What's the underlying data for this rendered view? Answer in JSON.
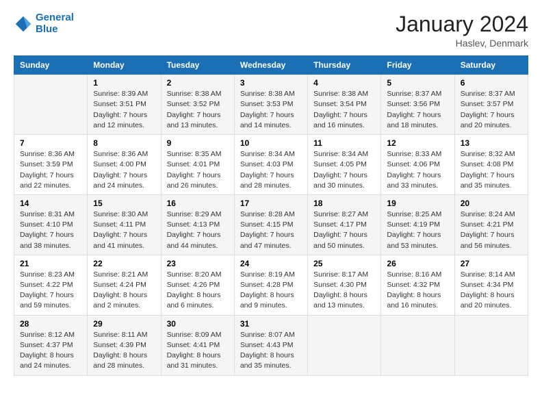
{
  "header": {
    "logo_line1": "General",
    "logo_line2": "Blue",
    "month_title": "January 2024",
    "location": "Haslev, Denmark"
  },
  "weekdays": [
    "Sunday",
    "Monday",
    "Tuesday",
    "Wednesday",
    "Thursday",
    "Friday",
    "Saturday"
  ],
  "weeks": [
    [
      {
        "day": "",
        "info": ""
      },
      {
        "day": "1",
        "info": "Sunrise: 8:39 AM\nSunset: 3:51 PM\nDaylight: 7 hours\nand 12 minutes."
      },
      {
        "day": "2",
        "info": "Sunrise: 8:38 AM\nSunset: 3:52 PM\nDaylight: 7 hours\nand 13 minutes."
      },
      {
        "day": "3",
        "info": "Sunrise: 8:38 AM\nSunset: 3:53 PM\nDaylight: 7 hours\nand 14 minutes."
      },
      {
        "day": "4",
        "info": "Sunrise: 8:38 AM\nSunset: 3:54 PM\nDaylight: 7 hours\nand 16 minutes."
      },
      {
        "day": "5",
        "info": "Sunrise: 8:37 AM\nSunset: 3:56 PM\nDaylight: 7 hours\nand 18 minutes."
      },
      {
        "day": "6",
        "info": "Sunrise: 8:37 AM\nSunset: 3:57 PM\nDaylight: 7 hours\nand 20 minutes."
      }
    ],
    [
      {
        "day": "7",
        "info": "Sunrise: 8:36 AM\nSunset: 3:59 PM\nDaylight: 7 hours\nand 22 minutes."
      },
      {
        "day": "8",
        "info": "Sunrise: 8:36 AM\nSunset: 4:00 PM\nDaylight: 7 hours\nand 24 minutes."
      },
      {
        "day": "9",
        "info": "Sunrise: 8:35 AM\nSunset: 4:01 PM\nDaylight: 7 hours\nand 26 minutes."
      },
      {
        "day": "10",
        "info": "Sunrise: 8:34 AM\nSunset: 4:03 PM\nDaylight: 7 hours\nand 28 minutes."
      },
      {
        "day": "11",
        "info": "Sunrise: 8:34 AM\nSunset: 4:05 PM\nDaylight: 7 hours\nand 30 minutes."
      },
      {
        "day": "12",
        "info": "Sunrise: 8:33 AM\nSunset: 4:06 PM\nDaylight: 7 hours\nand 33 minutes."
      },
      {
        "day": "13",
        "info": "Sunrise: 8:32 AM\nSunset: 4:08 PM\nDaylight: 7 hours\nand 35 minutes."
      }
    ],
    [
      {
        "day": "14",
        "info": "Sunrise: 8:31 AM\nSunset: 4:10 PM\nDaylight: 7 hours\nand 38 minutes."
      },
      {
        "day": "15",
        "info": "Sunrise: 8:30 AM\nSunset: 4:11 PM\nDaylight: 7 hours\nand 41 minutes."
      },
      {
        "day": "16",
        "info": "Sunrise: 8:29 AM\nSunset: 4:13 PM\nDaylight: 7 hours\nand 44 minutes."
      },
      {
        "day": "17",
        "info": "Sunrise: 8:28 AM\nSunset: 4:15 PM\nDaylight: 7 hours\nand 47 minutes."
      },
      {
        "day": "18",
        "info": "Sunrise: 8:27 AM\nSunset: 4:17 PM\nDaylight: 7 hours\nand 50 minutes."
      },
      {
        "day": "19",
        "info": "Sunrise: 8:25 AM\nSunset: 4:19 PM\nDaylight: 7 hours\nand 53 minutes."
      },
      {
        "day": "20",
        "info": "Sunrise: 8:24 AM\nSunset: 4:21 PM\nDaylight: 7 hours\nand 56 minutes."
      }
    ],
    [
      {
        "day": "21",
        "info": "Sunrise: 8:23 AM\nSunset: 4:22 PM\nDaylight: 7 hours\nand 59 minutes."
      },
      {
        "day": "22",
        "info": "Sunrise: 8:21 AM\nSunset: 4:24 PM\nDaylight: 8 hours\nand 2 minutes."
      },
      {
        "day": "23",
        "info": "Sunrise: 8:20 AM\nSunset: 4:26 PM\nDaylight: 8 hours\nand 6 minutes."
      },
      {
        "day": "24",
        "info": "Sunrise: 8:19 AM\nSunset: 4:28 PM\nDaylight: 8 hours\nand 9 minutes."
      },
      {
        "day": "25",
        "info": "Sunrise: 8:17 AM\nSunset: 4:30 PM\nDaylight: 8 hours\nand 13 minutes."
      },
      {
        "day": "26",
        "info": "Sunrise: 8:16 AM\nSunset: 4:32 PM\nDaylight: 8 hours\nand 16 minutes."
      },
      {
        "day": "27",
        "info": "Sunrise: 8:14 AM\nSunset: 4:34 PM\nDaylight: 8 hours\nand 20 minutes."
      }
    ],
    [
      {
        "day": "28",
        "info": "Sunrise: 8:12 AM\nSunset: 4:37 PM\nDaylight: 8 hours\nand 24 minutes."
      },
      {
        "day": "29",
        "info": "Sunrise: 8:11 AM\nSunset: 4:39 PM\nDaylight: 8 hours\nand 28 minutes."
      },
      {
        "day": "30",
        "info": "Sunrise: 8:09 AM\nSunset: 4:41 PM\nDaylight: 8 hours\nand 31 minutes."
      },
      {
        "day": "31",
        "info": "Sunrise: 8:07 AM\nSunset: 4:43 PM\nDaylight: 8 hours\nand 35 minutes."
      },
      {
        "day": "",
        "info": ""
      },
      {
        "day": "",
        "info": ""
      },
      {
        "day": "",
        "info": ""
      }
    ]
  ]
}
